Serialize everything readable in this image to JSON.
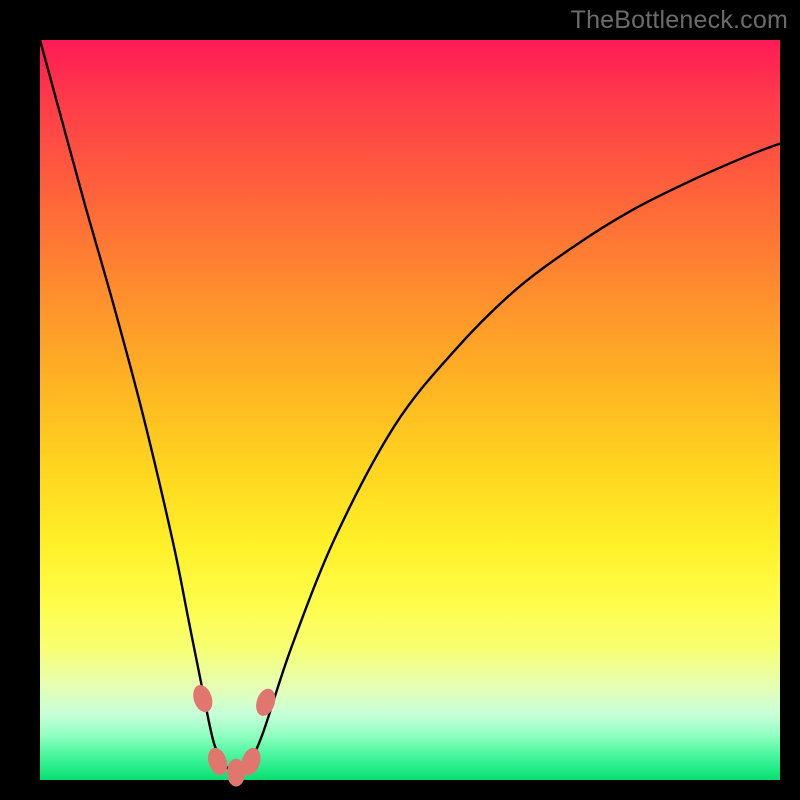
{
  "watermark": "TheBottleneck.com",
  "gradient": {
    "top": "#ff1a55",
    "mid": "#ffd61f",
    "bottom": "#06e070"
  },
  "stroke_color": "#000000",
  "marker_color": "#e0766d",
  "chart_data": {
    "type": "line",
    "title": "",
    "xlabel": "",
    "ylabel": "",
    "xlim": [
      0,
      100
    ],
    "ylim": [
      0,
      100
    ],
    "grid": false,
    "legend": false,
    "annotations": [],
    "series": [
      {
        "name": "bottleneck-curve",
        "x": [
          0,
          3,
          6,
          10,
          14,
          18,
          20,
          22,
          23.5,
          25,
          26.5,
          28,
          30,
          34,
          40,
          48,
          56,
          64,
          72,
          80,
          88,
          96,
          100
        ],
        "y": [
          100,
          89,
          78,
          64,
          49,
          32,
          22,
          12,
          5,
          2,
          1,
          2,
          6,
          18,
          33,
          48,
          58,
          66,
          72,
          77,
          81,
          84.5,
          86
        ]
      }
    ],
    "markers": [
      {
        "x": 22.0,
        "y": 11.0
      },
      {
        "x": 24.0,
        "y": 2.5
      },
      {
        "x": 26.5,
        "y": 1.0
      },
      {
        "x": 28.5,
        "y": 2.5
      },
      {
        "x": 30.5,
        "y": 10.5
      }
    ]
  }
}
